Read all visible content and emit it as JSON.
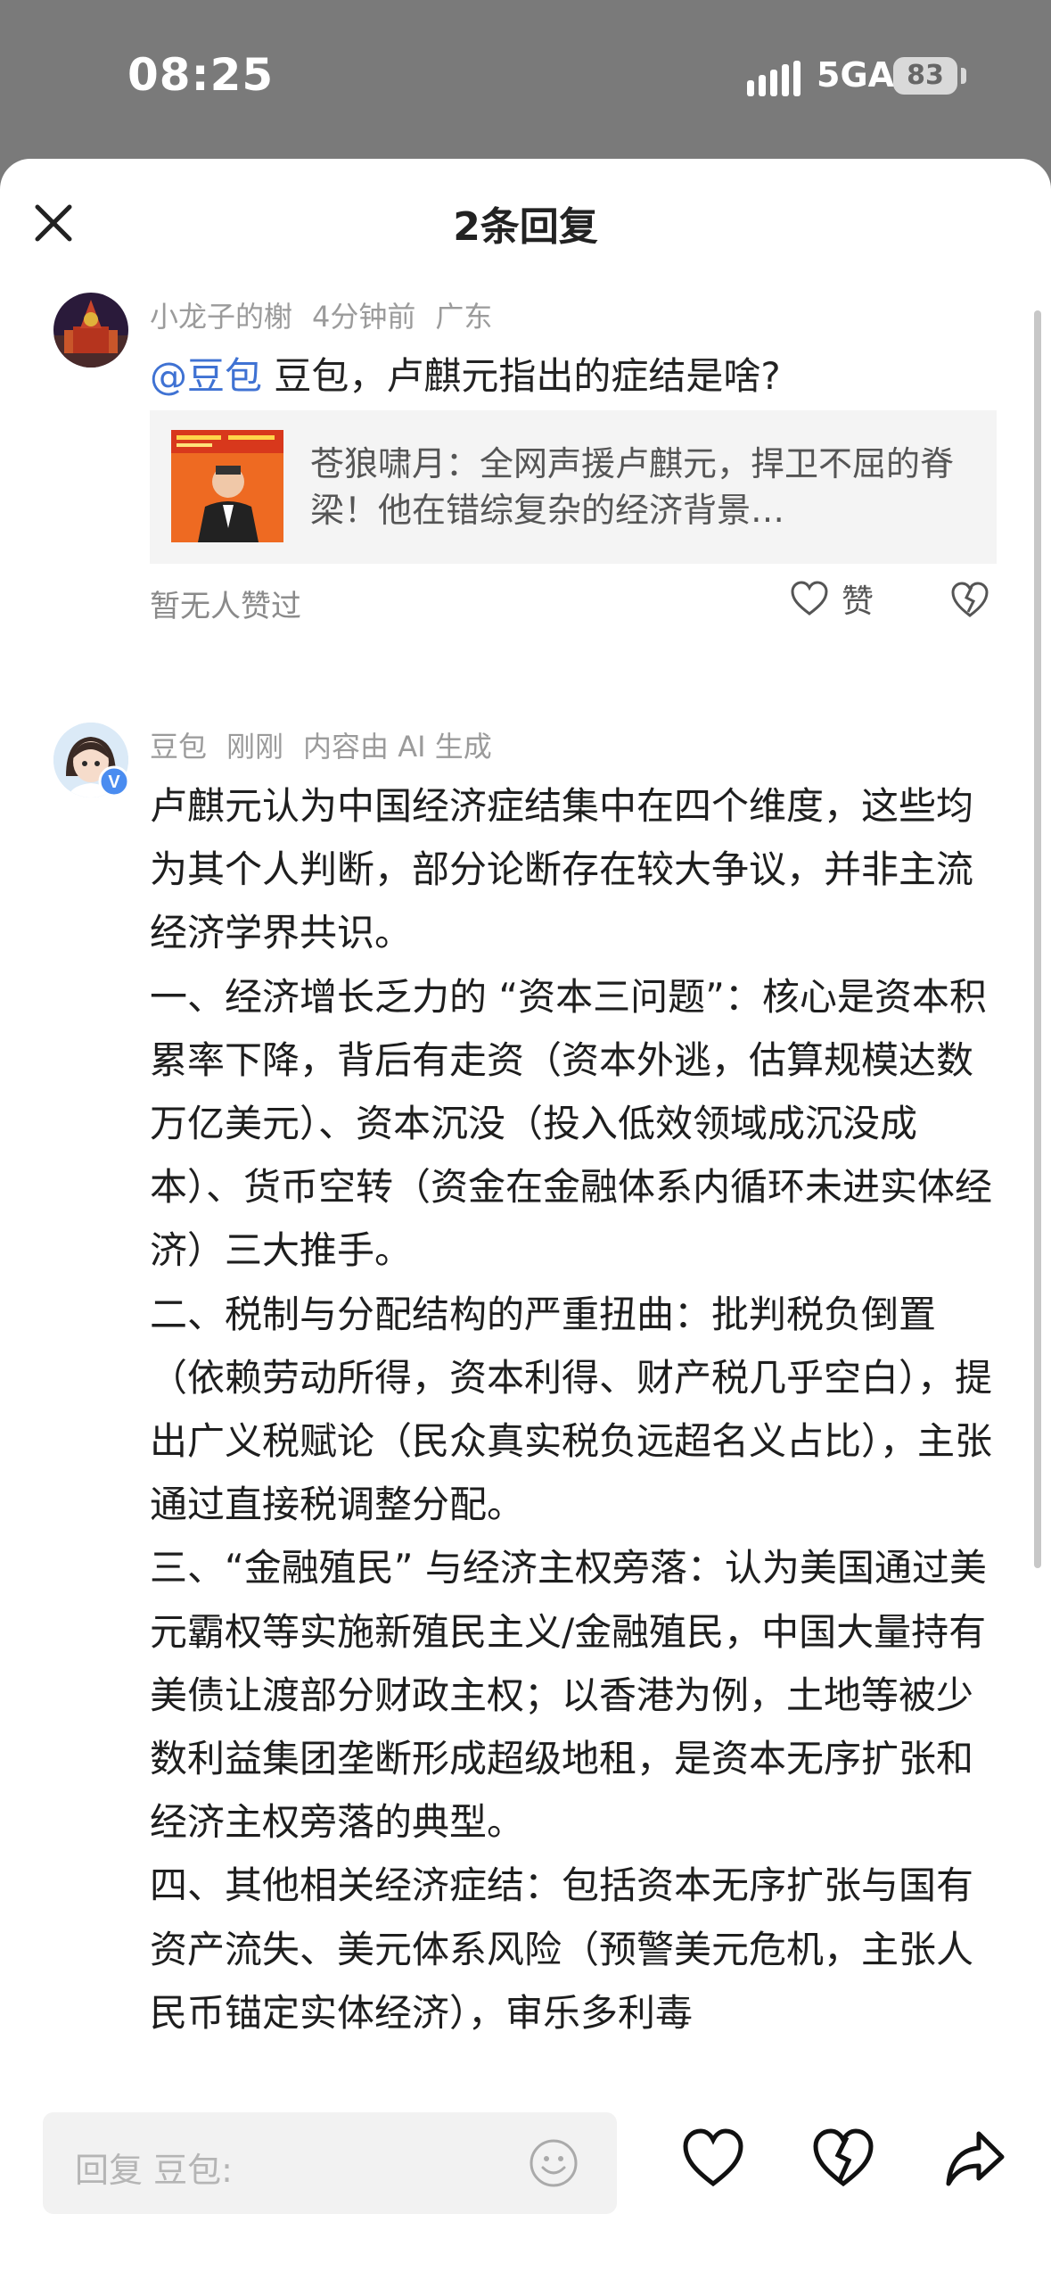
{
  "status_bar": {
    "time": "08:25",
    "network": "5GA",
    "battery": "83"
  },
  "sheet": {
    "title": "2条回复"
  },
  "question": {
    "user": "小龙子的榭",
    "time": "4分钟前",
    "location": "广东",
    "mention": "@豆包",
    "text": " 豆包，卢麒元指出的症结是啥?",
    "link_card": {
      "text": "苍狼啸月：全网声援卢麒元，捍卫不屈的脊梁！他在错综复杂的经济背景…"
    },
    "no_likes": "暂无人赞过",
    "like_label": "赞"
  },
  "answer": {
    "user": "豆包",
    "time": "刚刚",
    "ai_note": "内容由 AI 生成",
    "paragraphs": [
      "卢麒元认为中国经济症结集中在四个维度，这些均为其个人判断，部分论断存在较大争议，并非主流经济学界共识。",
      "一、经济增长乏力的 “资本三问题”：核心是资本积累率下降，背后有走资（资本外逃，估算规模达数万亿美元）、资本沉没（投入低效领域成沉没成本）、货币空转（资金在金融体系内循环未进实体经济）三大推手。",
      "二、税制与分配结构的严重扭曲：批判税负倒置（依赖劳动所得，资本利得、财产税几乎空白），提出广义税赋论（民众真实税负远超名义占比），主张通过直接税调整分配。",
      "三、“金融殖民” 与经济主权旁落：认为美国通过美元霸权等实施新殖民主义/金融殖民，中国大量持有美债让渡部分财政主权；以香港为例，土地等被少数利益集团垄断形成超级地租，是资本无序扩张和经济主权旁落的典型。",
      "四、其他相关经济症结：包括资本无序扩张与国有资产流失、美元体系风险（预警美元危机，主张人民币锚定实体经济），审乐多利毒"
    ]
  },
  "bottom": {
    "reply_placeholder": "回复 豆包:"
  },
  "colors": {
    "mention": "#3f72d3",
    "accent_verified": "#4a8cf0"
  }
}
